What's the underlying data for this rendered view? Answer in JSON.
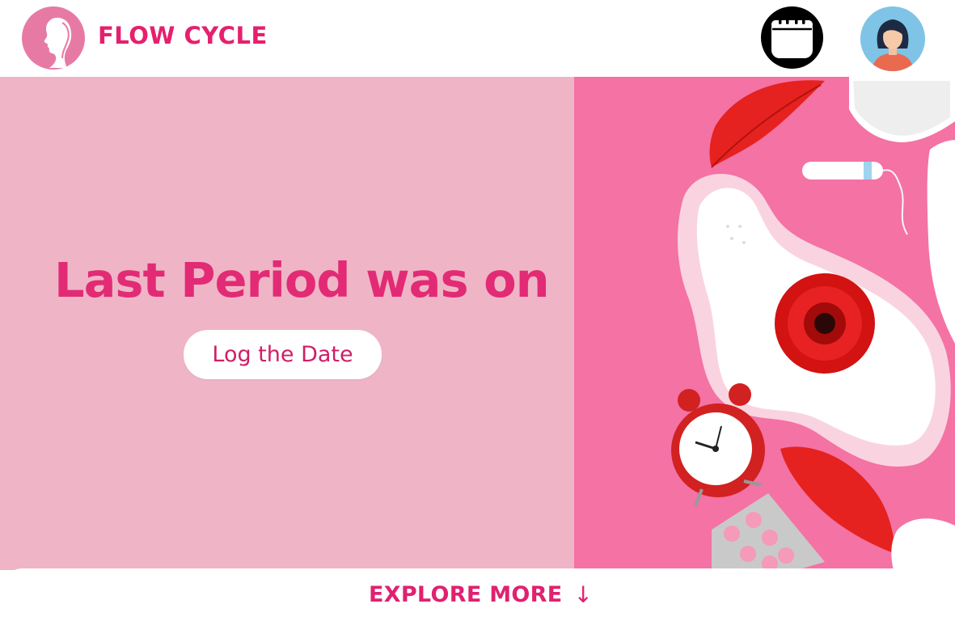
{
  "header": {
    "brand_name": "FLOW CYCLE",
    "logo_icon": "woman-silhouette-logo-icon",
    "calendar_icon": "calendar-icon",
    "avatar_icon": "user-avatar"
  },
  "hero": {
    "title": "Last Period was on",
    "log_button_label": "Log the Date",
    "image_description_icon": "period-products-photo"
  },
  "footer": {
    "explore_label": "EXPLORE MORE",
    "explore_arrow": "↓"
  },
  "colors": {
    "brand_pink": "#e5206e",
    "hero_left_bg": "#efb5c7",
    "hero_right_bg": "#f472a4",
    "logo_bg": "#e77aa5"
  }
}
